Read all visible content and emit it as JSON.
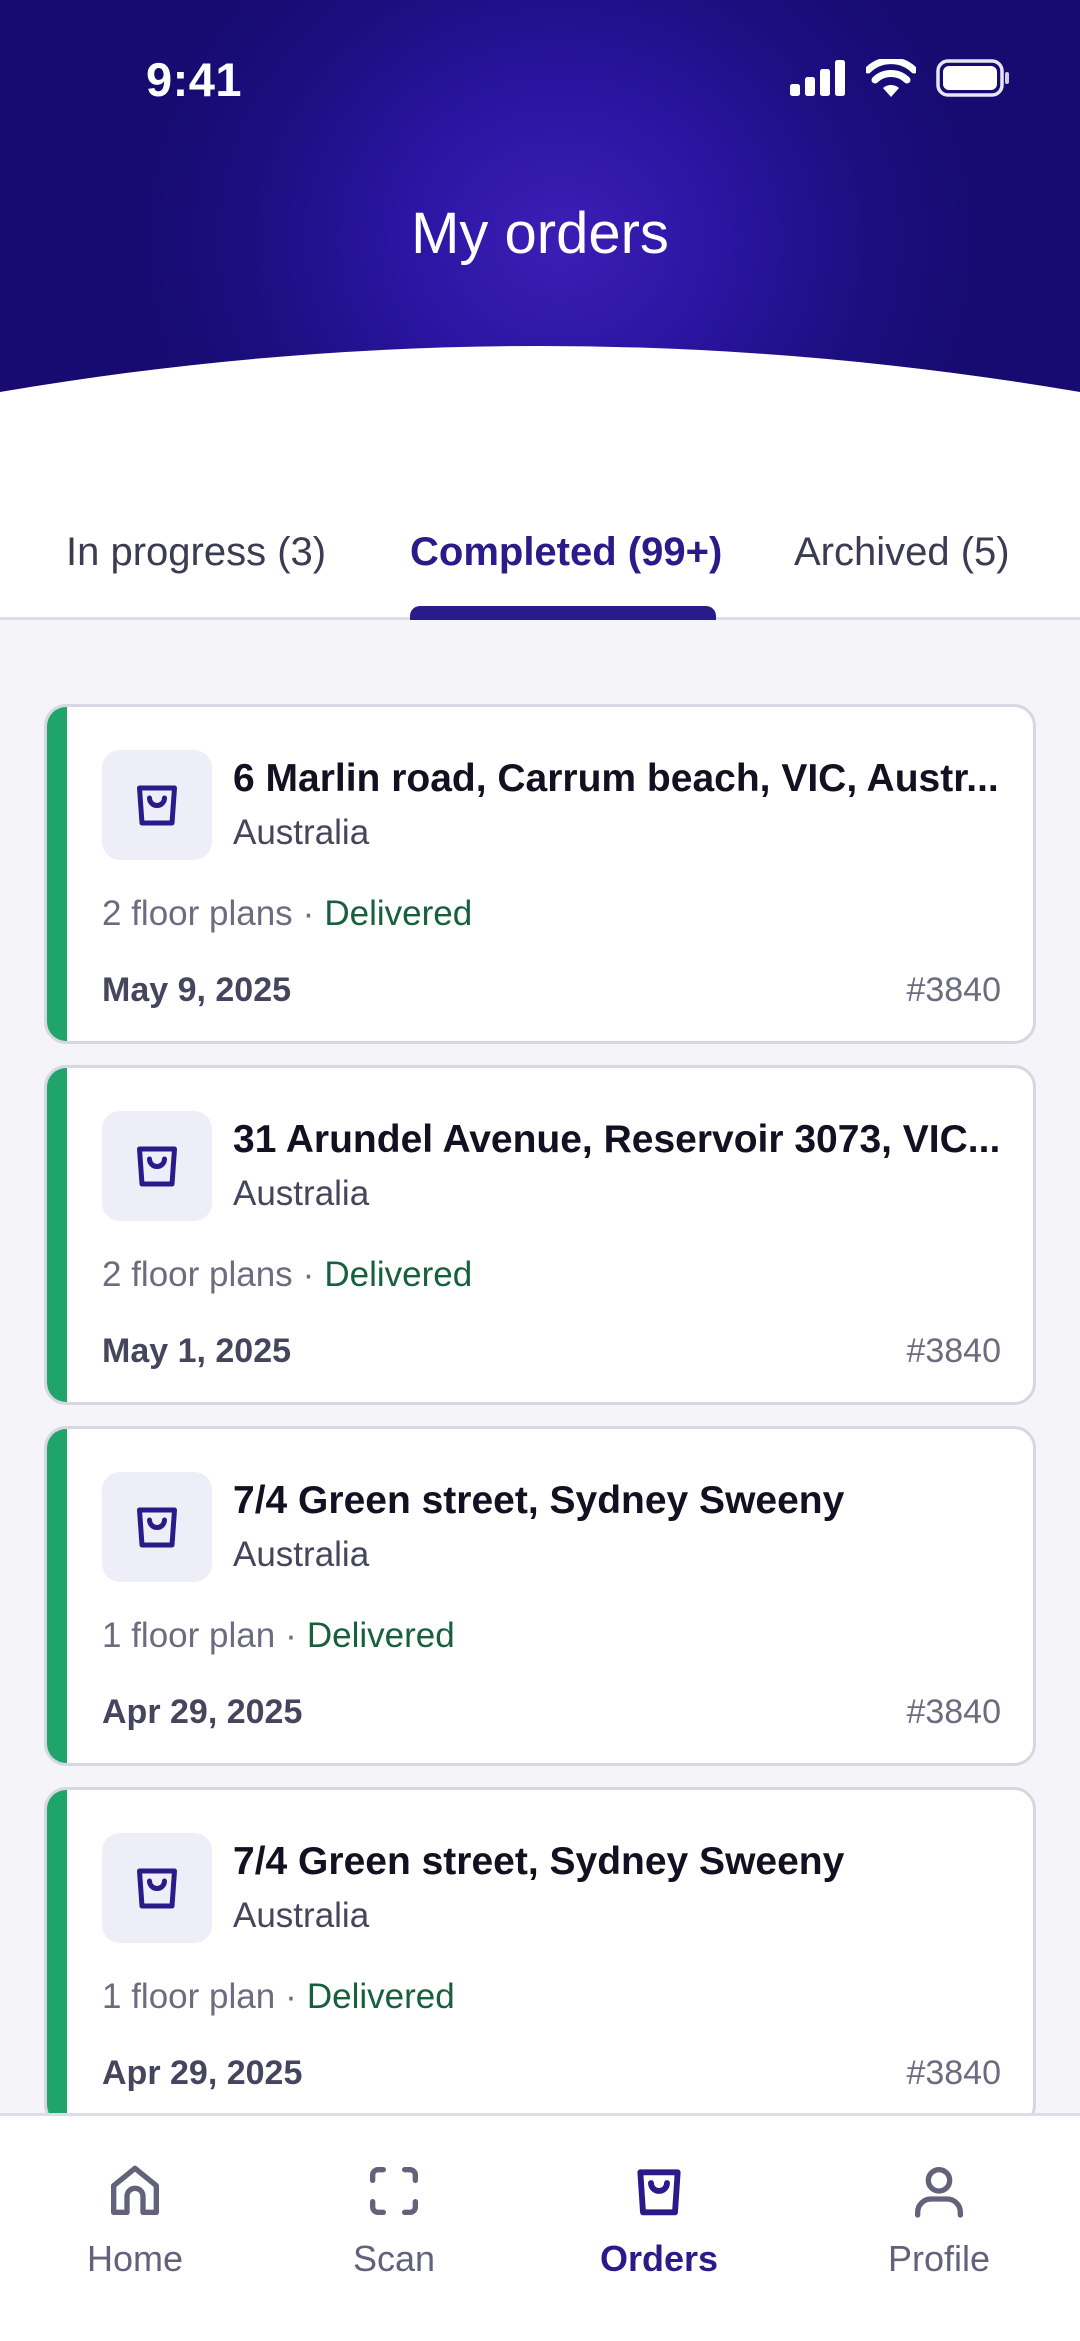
{
  "status_bar": {
    "time": "9:41"
  },
  "header": {
    "title": "My orders"
  },
  "tabs": [
    {
      "label": "In progress (3)",
      "active": false
    },
    {
      "label": "Completed (99+)",
      "active": true
    },
    {
      "label": "Archived (5)",
      "active": false
    }
  ],
  "orders": [
    {
      "title": "6 Marlin road, Carrum beach, VIC, Austr...",
      "country": "Australia",
      "plans": "2 floor plans",
      "separator": "·",
      "status": "Delivered",
      "date": "May 9, 2025",
      "id": "#3840"
    },
    {
      "title": "31 Arundel Avenue, Reservoir 3073, VIC...",
      "country": "Australia",
      "plans": "2 floor plans",
      "separator": "·",
      "status": "Delivered",
      "date": "May 1, 2025",
      "id": "#3840"
    },
    {
      "title": "7/4 Green street, Sydney Sweeny",
      "country": "Australia",
      "plans": "1 floor plan",
      "separator": "·",
      "status": "Delivered",
      "date": "Apr 29, 2025",
      "id": "#3840"
    },
    {
      "title": "7/4 Green street, Sydney Sweeny",
      "country": "Australia",
      "plans": "1 floor plan",
      "separator": "·",
      "status": "Delivered",
      "date": "Apr 29, 2025",
      "id": "#3840"
    }
  ],
  "nav": [
    {
      "label": "Home",
      "icon": "home-icon",
      "active": false
    },
    {
      "label": "Scan",
      "icon": "scan-icon",
      "active": false
    },
    {
      "label": "Orders",
      "icon": "shopping-bag-icon",
      "active": true
    },
    {
      "label": "Profile",
      "icon": "person-icon",
      "active": false
    }
  ],
  "colors": {
    "primary": "#2a1b8a",
    "header_gradient": "#1c0e7e",
    "delivered_bar": "#1fa56a",
    "delivered_text": "#17603d"
  }
}
